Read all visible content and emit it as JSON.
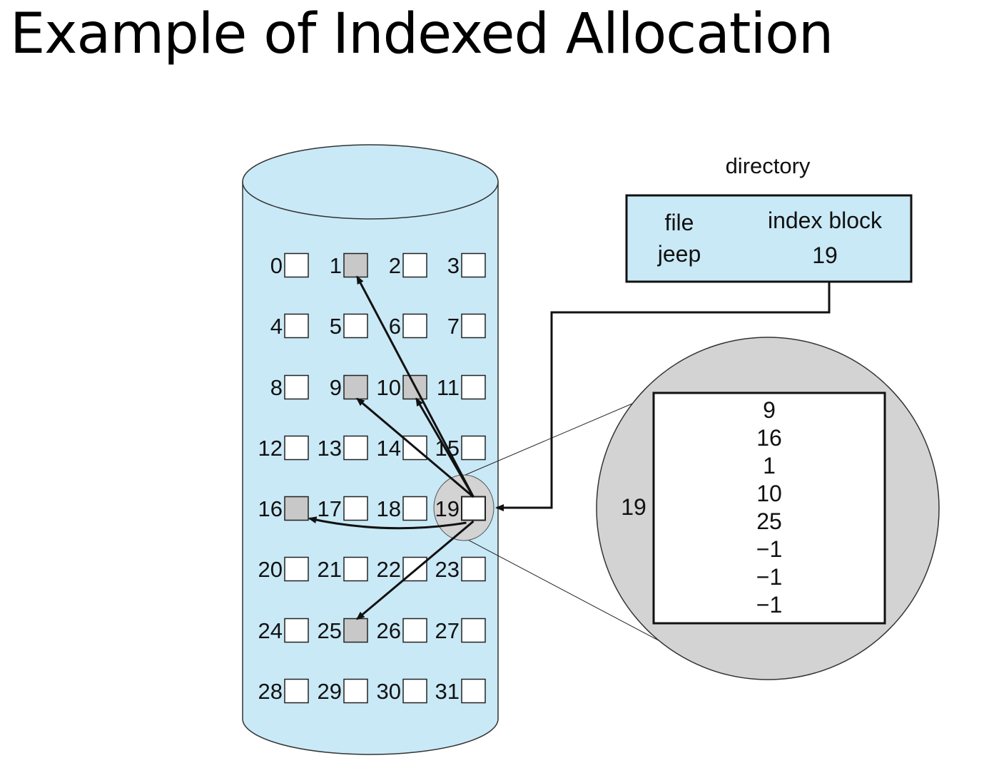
{
  "title": "Example of Indexed Allocation",
  "colors": {
    "disk_fill": "#c9e9f6",
    "used_block": "#c8c8c8",
    "free_block": "#ffffff",
    "directory_fill": "#c9e9f6",
    "zoom_fill": "#d3d3d3"
  },
  "disk": {
    "blocks": [
      {
        "label": "0",
        "state": "free"
      },
      {
        "label": "1",
        "state": "used"
      },
      {
        "label": "2",
        "state": "free"
      },
      {
        "label": "3",
        "state": "free"
      },
      {
        "label": "4",
        "state": "free"
      },
      {
        "label": "5",
        "state": "free"
      },
      {
        "label": "6",
        "state": "free"
      },
      {
        "label": "7",
        "state": "free"
      },
      {
        "label": "8",
        "state": "free"
      },
      {
        "label": "9",
        "state": "used"
      },
      {
        "label": "10",
        "state": "used"
      },
      {
        "label": "11",
        "state": "free"
      },
      {
        "label": "12",
        "state": "free"
      },
      {
        "label": "13",
        "state": "free"
      },
      {
        "label": "14",
        "state": "free"
      },
      {
        "label": "15",
        "state": "free"
      },
      {
        "label": "16",
        "state": "used"
      },
      {
        "label": "17",
        "state": "free"
      },
      {
        "label": "18",
        "state": "free"
      },
      {
        "label": "19",
        "state": "index"
      },
      {
        "label": "20",
        "state": "free"
      },
      {
        "label": "21",
        "state": "free"
      },
      {
        "label": "22",
        "state": "free"
      },
      {
        "label": "23",
        "state": "free"
      },
      {
        "label": "24",
        "state": "free"
      },
      {
        "label": "25",
        "state": "used"
      },
      {
        "label": "26",
        "state": "free"
      },
      {
        "label": "27",
        "state": "free"
      },
      {
        "label": "28",
        "state": "free"
      },
      {
        "label": "29",
        "state": "free"
      },
      {
        "label": "30",
        "state": "free"
      },
      {
        "label": "31",
        "state": "free"
      }
    ]
  },
  "directory": {
    "title": "directory",
    "col_file": "file",
    "col_index": "index block",
    "file_name": "jeep",
    "index_value": "19"
  },
  "index_block": {
    "label": "19",
    "entries": [
      "9",
      "16",
      "1",
      "10",
      "25",
      "−1",
      "−1",
      "−1"
    ]
  },
  "pointers_from": "19",
  "pointers_to": [
    "1",
    "9",
    "10",
    "16",
    "25"
  ]
}
